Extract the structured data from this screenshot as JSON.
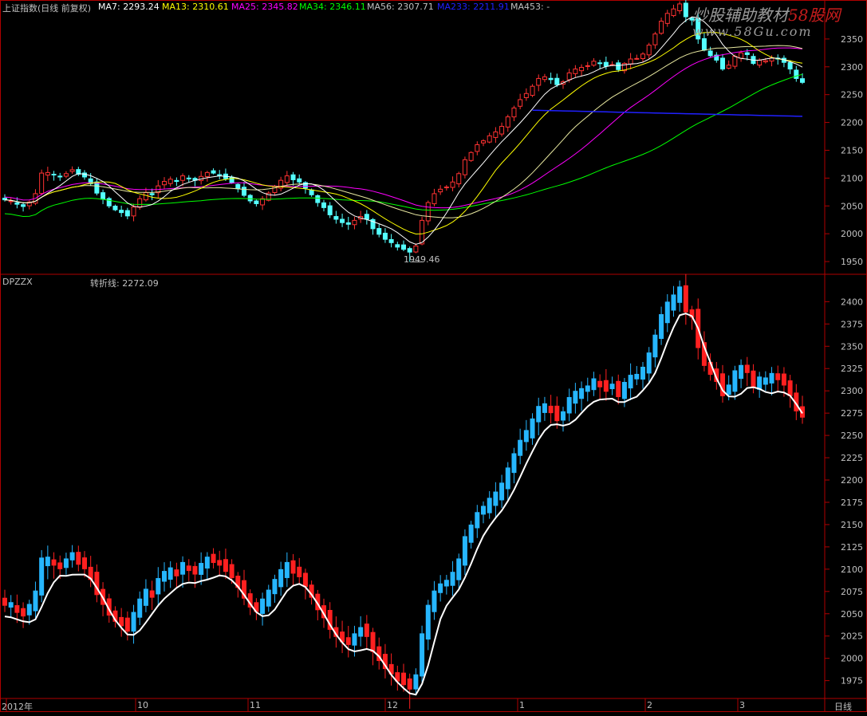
{
  "header": {
    "index_label": "上证指数(日线 前复权)",
    "ma7": "MA7: 2293.24",
    "ma13": "MA13: 2310.61",
    "ma25": "MA25: 2345.82",
    "ma34": "MA34: 2346.11",
    "ma56": "MA56: 2307.71",
    "ma233": "MA233: 2211.91",
    "ma453": "MA453: -"
  },
  "watermark": {
    "title_gray": "炒股辅助教材",
    "title_red": "58股网",
    "url": "www.58Gu.com"
  },
  "lower_header": {
    "indicator": "DPZZX",
    "turn_line": "转折线: 2272.09"
  },
  "low_marker": "1949.46",
  "x_axis_months": [
    "2012年",
    "10",
    "11",
    "12",
    "1",
    "2",
    "3"
  ],
  "period_label": "日线",
  "colors": {
    "up": "#ff3232",
    "down": "#54ffff",
    "bg": "#000000",
    "frame": "#b00000",
    "ma7": "#ffffff",
    "ma13": "#ffff00",
    "ma25": "#ff00ff",
    "ma34": "#00ff00",
    "ma56": "#ffffff",
    "ma233": "#2020ff",
    "lower_up": "#ff2020",
    "lower_down": "#26b6ff",
    "turn_line": "#ffffff"
  },
  "chart_data": [
    {
      "type": "candlestick",
      "title": "上证指数(日线 前复权)",
      "y_ticks": [
        1950,
        2000,
        2050,
        2100,
        2150,
        2200,
        2250,
        2300,
        2350
      ],
      "ylim": [
        1930,
        2400
      ],
      "closes": [
        2061,
        2059,
        2053,
        2049,
        2057,
        2072,
        2109,
        2110,
        2106,
        2102,
        2108,
        2115,
        2107,
        2102,
        2090,
        2073,
        2062,
        2050,
        2043,
        2038,
        2032,
        2048,
        2063,
        2074,
        2070,
        2086,
        2094,
        2098,
        2094,
        2104,
        2100,
        2096,
        2103,
        2110,
        2109,
        2106,
        2099,
        2092,
        2081,
        2069,
        2059,
        2054,
        2063,
        2073,
        2085,
        2096,
        2104,
        2097,
        2093,
        2082,
        2070,
        2056,
        2047,
        2034,
        2026,
        2020,
        2017,
        2024,
        2031,
        2026,
        2009,
        1999,
        1990,
        1984,
        1976,
        1972,
        1967,
        1978,
        2024,
        2056,
        2072,
        2080,
        2084,
        2093,
        2108,
        2133,
        2146,
        2160,
        2167,
        2176,
        2183,
        2193,
        2210,
        2226,
        2241,
        2252,
        2265,
        2279,
        2282,
        2277,
        2268,
        2273,
        2289,
        2296,
        2299,
        2302,
        2310,
        2306,
        2301,
        2304,
        2295,
        2306,
        2314,
        2315,
        2323,
        2339,
        2359,
        2382,
        2396,
        2404,
        2413,
        2390,
        2384,
        2350,
        2330,
        2320,
        2312,
        2296,
        2303,
        2319,
        2325,
        2322,
        2306,
        2312,
        2311,
        2316,
        2314,
        2308,
        2296,
        2279,
        2272
      ],
      "low_label": "1949.46",
      "series": [
        {
          "name": "MA7",
          "value": 2293.24
        },
        {
          "name": "MA13",
          "value": 2310.61
        },
        {
          "name": "MA25",
          "value": 2345.82
        },
        {
          "name": "MA34",
          "value": 2346.11
        },
        {
          "name": "MA56",
          "value": 2307.71
        },
        {
          "name": "MA233",
          "value": 2211.91
        }
      ]
    },
    {
      "type": "candlestick",
      "title": "DPZZX",
      "y_ticks": [
        1975,
        2000,
        2025,
        2050,
        2075,
        2100,
        2125,
        2150,
        2175,
        2200,
        2225,
        2250,
        2275,
        2300,
        2325,
        2350,
        2375,
        2400
      ],
      "ylim": [
        1955,
        2420
      ],
      "series": [
        {
          "name": "转折线",
          "value": 2272.09
        }
      ]
    }
  ]
}
